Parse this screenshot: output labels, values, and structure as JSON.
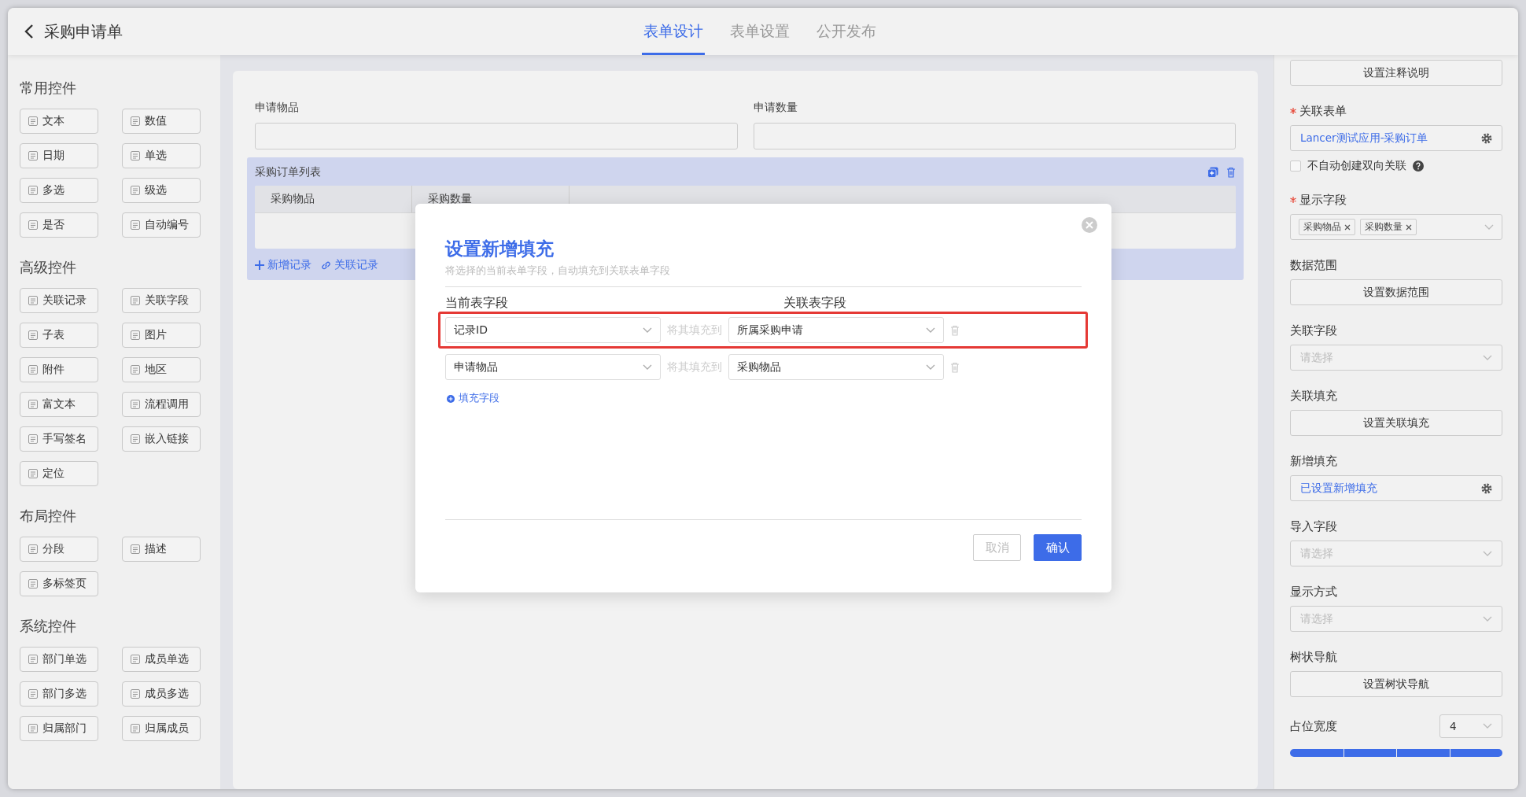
{
  "header": {
    "title": "采购申请单"
  },
  "tabs": [
    {
      "label": "表单设计",
      "selected": true
    },
    {
      "label": "表单设置",
      "selected": false
    },
    {
      "label": "公开发布",
      "selected": false
    }
  ],
  "palette": [
    {
      "title": "常用控件",
      "items": [
        "文本",
        "数值",
        "日期",
        "单选",
        "多选",
        "级选",
        "是否",
        "自动编号"
      ]
    },
    {
      "title": "高级控件",
      "items": [
        "关联记录",
        "关联字段",
        "子表",
        "图片",
        "附件",
        "地区",
        "富文本",
        "流程调用",
        "手写签名",
        "嵌入链接",
        "定位"
      ]
    },
    {
      "title": "布局控件",
      "items": [
        "分段",
        "描述",
        "多标签页"
      ]
    },
    {
      "title": "系统控件",
      "items": [
        "部门单选",
        "成员单选",
        "部门多选",
        "成员多选",
        "归属部门",
        "归属成员"
      ]
    }
  ],
  "canvas": {
    "fields": [
      {
        "label": "申请物品"
      },
      {
        "label": "申请数量"
      }
    ],
    "subtable": {
      "title": "采购订单列表",
      "columns": [
        "采购物品",
        "采购数量"
      ],
      "actions": [
        "新增记录",
        "关联记录"
      ]
    }
  },
  "properties": [
    {
      "kind": "button",
      "text": "设置注释说明"
    },
    {
      "kind": "link",
      "label": "关联表单",
      "required": true,
      "value": "Lancer测试应用-采购订单"
    },
    {
      "kind": "checkbox",
      "text": "不自动创建双向关联",
      "checked": false
    },
    {
      "kind": "tags",
      "label": "显示字段",
      "required": true,
      "tags": [
        "采购物品",
        "采购数量"
      ]
    },
    {
      "kind": "button",
      "label": "数据范围",
      "required": false,
      "text": "设置数据范围"
    },
    {
      "kind": "select",
      "label": "关联字段",
      "required": false,
      "placeholder": "请选择"
    },
    {
      "kind": "button",
      "label": "关联填充",
      "required": false,
      "text": "设置关联填充"
    },
    {
      "kind": "link",
      "label": "新增填充",
      "required": false,
      "value": "已设置新增填充"
    },
    {
      "kind": "select",
      "label": "导入字段",
      "required": false,
      "placeholder": "请选择"
    },
    {
      "kind": "select",
      "label": "显示方式",
      "required": false,
      "placeholder": "请选择"
    },
    {
      "kind": "button",
      "label": "树状导航",
      "required": false,
      "text": "设置树状导航"
    },
    {
      "kind": "width",
      "label": "占位宽度",
      "required": false,
      "value": "4",
      "level": 1
    }
  ],
  "dialog": {
    "title": "设置新增填充",
    "subtitle": "将选择的当前表单字段，自动填充到关联表单字段",
    "column_headers": [
      "当前表字段",
      "关联表字段"
    ],
    "rows": [
      {
        "source": "记录ID",
        "connector": "将其填充到",
        "target": "所属采购申请",
        "highlighted": true
      },
      {
        "source": "申请物品",
        "connector": "将其填充到",
        "target": "采购物品",
        "highlighted": false
      }
    ],
    "add_link": "填充字段",
    "buttons": [
      {
        "label": "取消",
        "kind": "secondary"
      },
      {
        "label": "确认",
        "kind": "primary"
      }
    ]
  }
}
